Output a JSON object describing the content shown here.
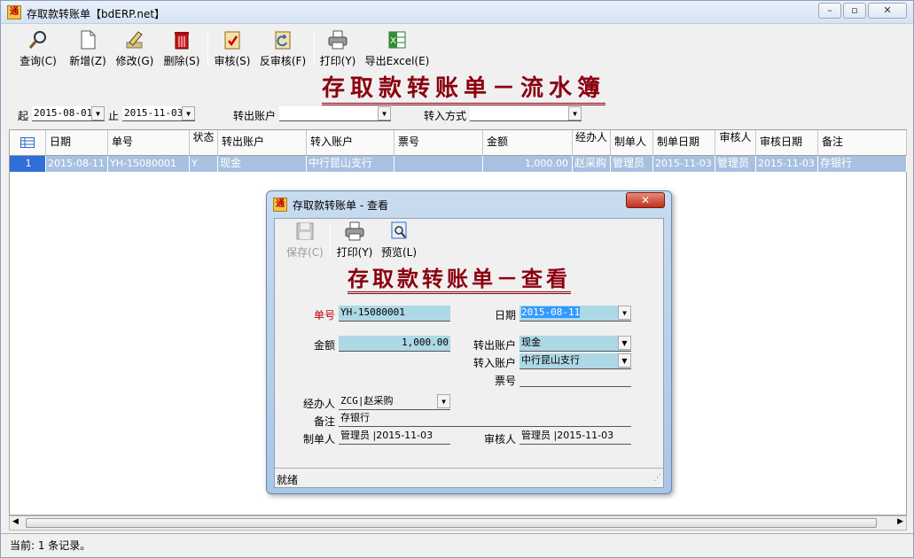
{
  "window": {
    "title": "存取款转账单【bdERP.net】",
    "icon_text": "通"
  },
  "toolbar": {
    "query": "查询(C)",
    "new": "新增(Z)",
    "edit": "修改(G)",
    "delete": "删除(S)",
    "audit": "审核(S)",
    "unaudit": "反审核(F)",
    "print": "打印(Y)",
    "export": "导出Excel(E)"
  },
  "page_title": "存取款转账单－流水簿",
  "filters": {
    "from_label": "起",
    "from_date": "2015-08-01",
    "to_label": "止",
    "to_date": "2015-11-03",
    "out_account_label": "转出账户",
    "out_account_value": "",
    "in_method_label": "转入方式",
    "in_method_value": ""
  },
  "grid": {
    "columns": [
      "日期",
      "单号",
      "状态",
      "转出账户",
      "转入账户",
      "票号",
      "金额",
      "经办人",
      "制单人",
      "制单日期",
      "审核人",
      "审核日期",
      "备注"
    ],
    "rows": [
      [
        "1",
        "2015-08-11",
        "YH-15080001",
        "Y",
        "现金",
        "中行昆山支行",
        "",
        "1,000.00",
        "赵采购",
        "管理员",
        "2015-11-03",
        "管理员",
        "2015-11-03",
        "存银行"
      ]
    ]
  },
  "status_bar": "当前: 1 条记录。",
  "dialog": {
    "title": "存取款转账单 - 查看",
    "save": "保存(C)",
    "print": "打印(Y)",
    "preview": "预览(L)",
    "heading": "存取款转账单－查看",
    "fields": {
      "no_label": "单号",
      "no_value": "YH-15080001",
      "date_label": "日期",
      "date_value": "2015-08-11",
      "amount_label": "金额",
      "amount_value": "1,000.00",
      "out_label": "转出账户",
      "out_value": "现金",
      "in_label": "转入账户",
      "in_value": "中行昆山支行",
      "ticket_label": "票号",
      "ticket_value": "",
      "handler_label": "经办人",
      "handler_value": "ZCG|赵采购",
      "memo_label": "备注",
      "memo_value": "存银行",
      "maker_label": "制单人",
      "maker_value": "管理员 |2015-11-03",
      "auditor_label": "审核人",
      "auditor_value": "管理员 |2015-11-03"
    },
    "status": "就绪"
  }
}
